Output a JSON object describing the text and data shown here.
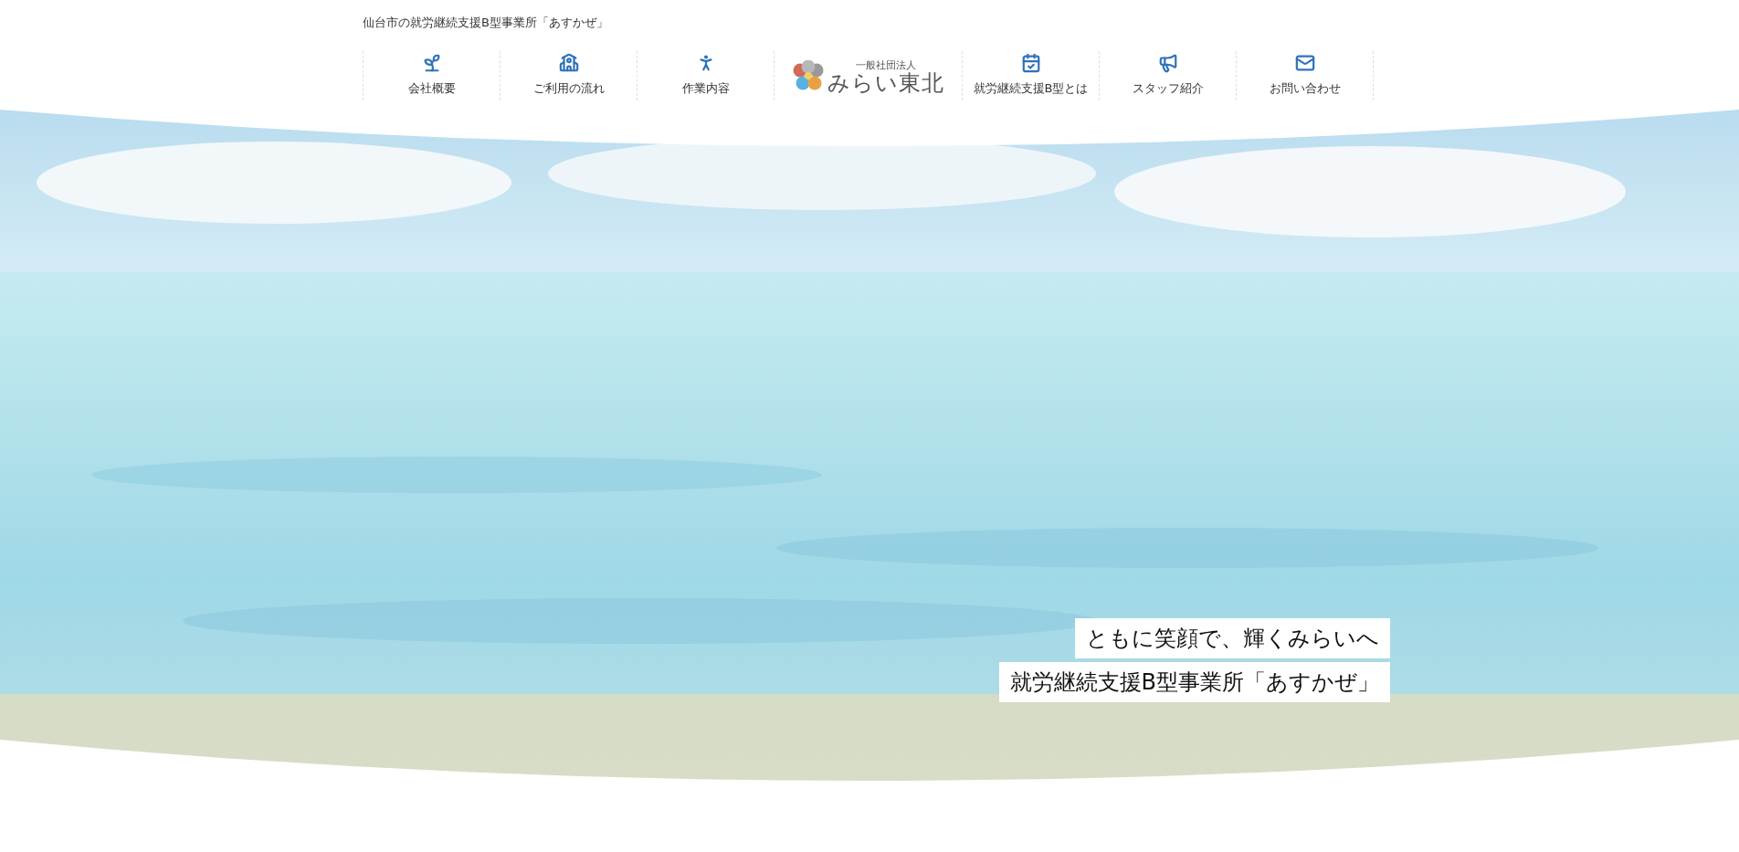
{
  "tagline": "仙台市の就労継続支援B型事業所「あすかぜ」",
  "nav_left": [
    {
      "label": "会社概要"
    },
    {
      "label": "ご利用の流れ"
    },
    {
      "label": "作業内容"
    }
  ],
  "logo": {
    "small": "一般社団法人",
    "name": "みらい東北"
  },
  "nav_right": [
    {
      "label": "就労継続支援B型とは"
    },
    {
      "label": "スタッフ紹介"
    },
    {
      "label": "お問い合わせ"
    }
  ],
  "hero": {
    "captions": [
      "ともに笑顔で、輝くみらいへ",
      "就労継続支援B型事業所「あすかぜ」"
    ]
  }
}
